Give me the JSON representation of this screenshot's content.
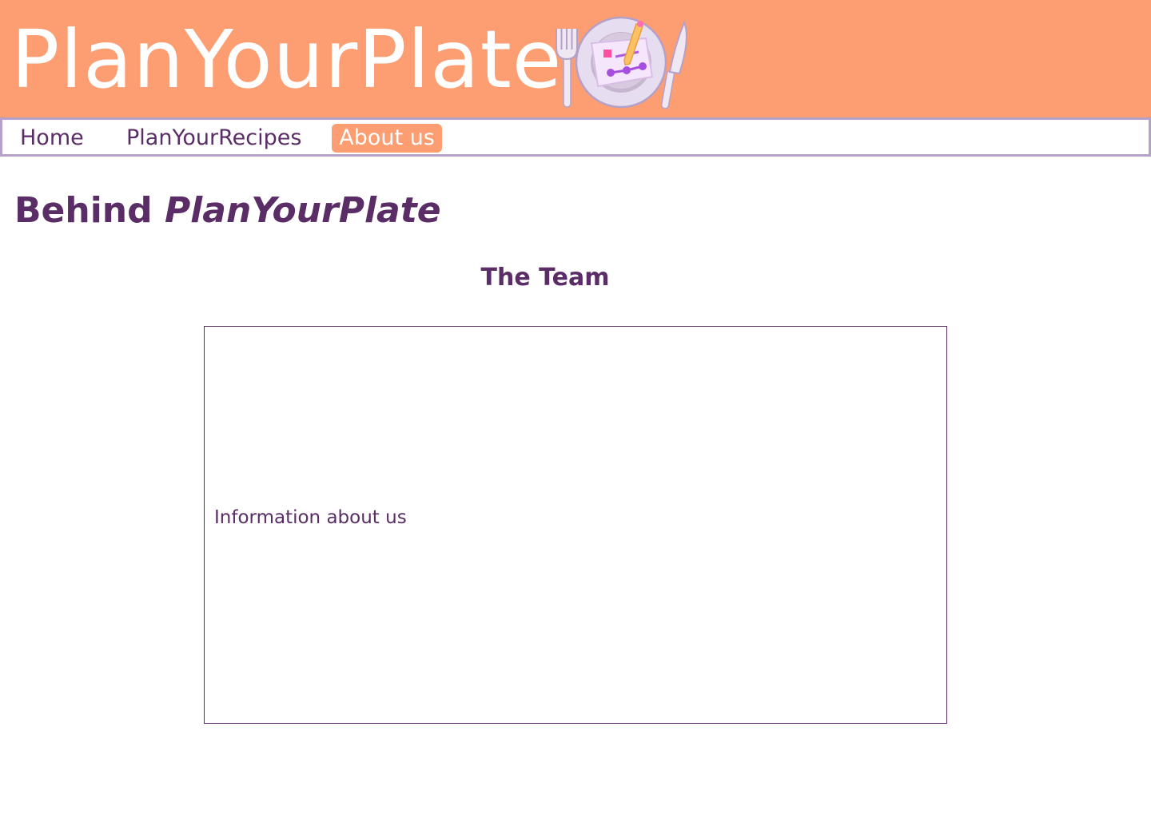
{
  "header": {
    "brand": "PlanYourPlate",
    "logo_icon": "plate-planner-logo-icon"
  },
  "nav": {
    "items": [
      {
        "label": "Home",
        "active": false
      },
      {
        "label": "PlanYourRecipes",
        "active": false
      },
      {
        "label": "About us",
        "active": true
      }
    ]
  },
  "main": {
    "title_prefix": "Behind",
    "title_emphasis": "PlanYourPlate",
    "team_heading": "The Team",
    "info_text": "Information about us"
  },
  "colors": {
    "header_bg": "#fd9d72",
    "text": "#5a2d66",
    "nav_border": "#b5a0c8",
    "active_nav_bg": "#fd9d72"
  }
}
